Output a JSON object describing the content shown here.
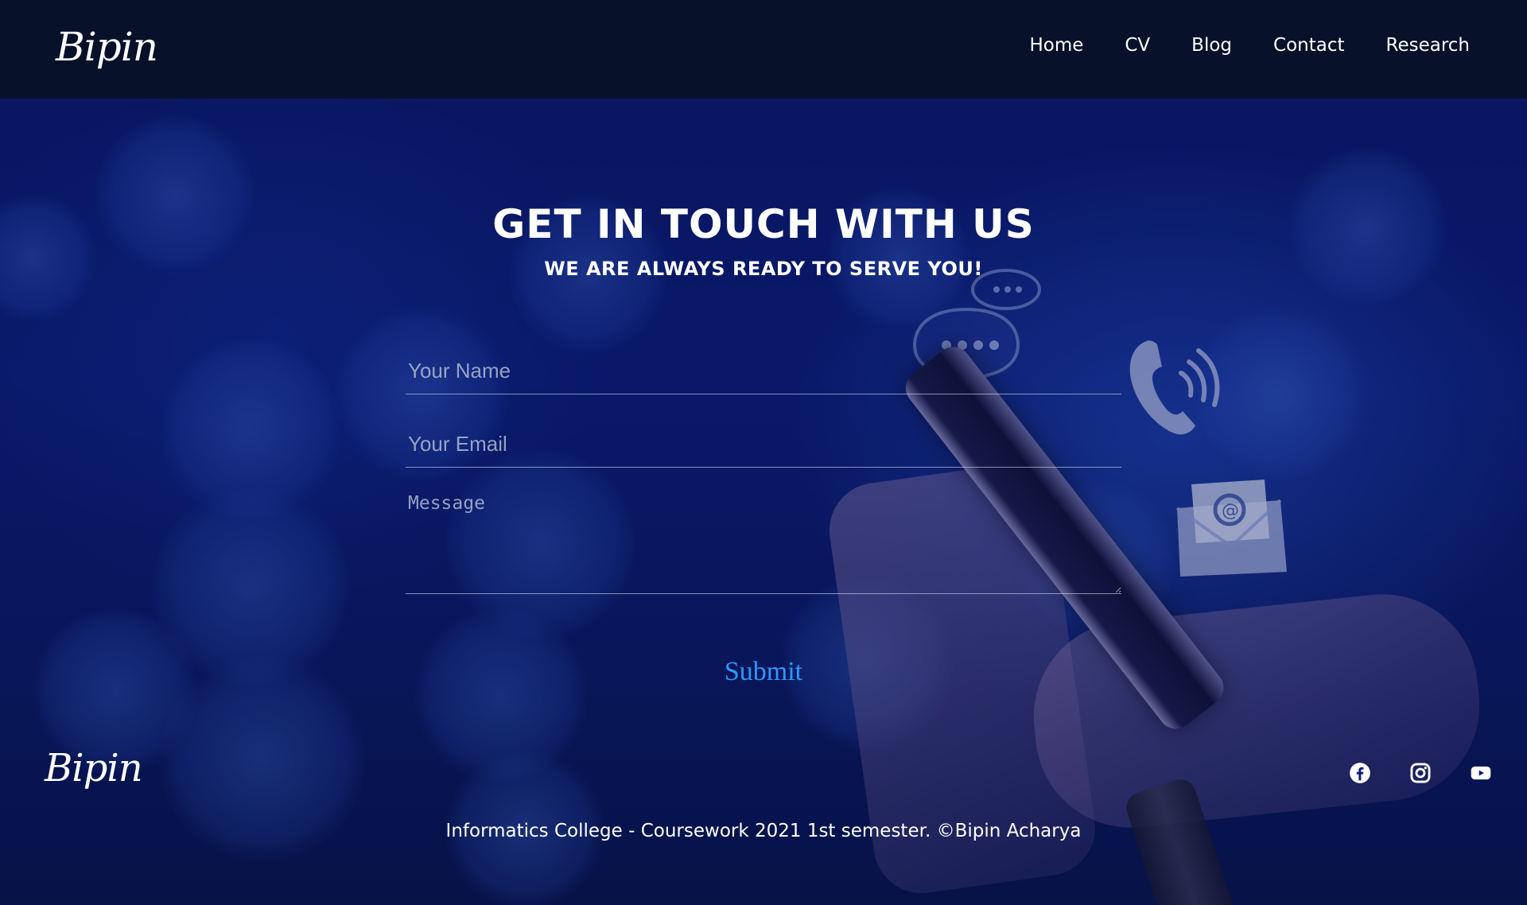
{
  "header": {
    "logo": "Bipin",
    "nav": [
      {
        "label": "Home"
      },
      {
        "label": "CV"
      },
      {
        "label": "Blog"
      },
      {
        "label": "Contact"
      },
      {
        "label": "Research"
      }
    ]
  },
  "contact": {
    "title": "GET IN TOUCH WITH US",
    "subtitle": "WE ARE ALWAYS READY TO SERVE YOU!",
    "name_placeholder": "Your Name",
    "email_placeholder": "Your Email",
    "message_placeholder": "Message",
    "submit_label": "Submit",
    "submit_color": "#2f97ff"
  },
  "footer": {
    "logo": "Bipin",
    "socials": [
      {
        "icon": "facebook-icon"
      },
      {
        "icon": "instagram-icon"
      },
      {
        "icon": "youtube-icon"
      }
    ],
    "copyright": "Informatics College - Coursework 2021 1st semester. ©Bipin Acharya"
  },
  "colors": {
    "header_bg": "#08112a",
    "background": "#0b1d78",
    "text": "#ffffff"
  }
}
